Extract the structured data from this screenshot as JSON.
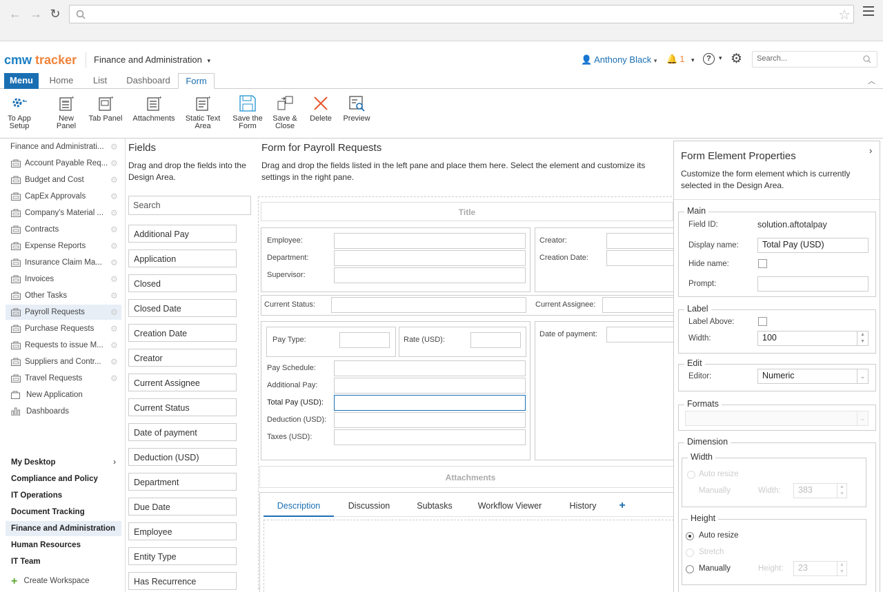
{
  "app": {
    "logo_cmw": "cmw",
    "logo_tracker": "tracker",
    "workspace": "Finance and Administration",
    "user": "Anthony Black",
    "notif_count": "1",
    "search_placeholder": "Search..."
  },
  "tabs": [
    "Menu",
    "Home",
    "List",
    "Dashboard",
    "Form"
  ],
  "ribbon": [
    {
      "l1": "To App",
      "l2": "Setup",
      "icon": "gear-back-icon"
    },
    {
      "l1": "New",
      "l2": "Panel",
      "icon": "new-panel-icon"
    },
    {
      "l1": "Tab Panel",
      "l2": "",
      "icon": "tab-panel-icon"
    },
    {
      "l1": "Attachments",
      "l2": "",
      "icon": "attachments-icon"
    },
    {
      "l1": "Static Text",
      "l2": "Area",
      "icon": "static-text-icon"
    },
    {
      "l1": "Save the",
      "l2": "Form",
      "icon": "save-icon"
    },
    {
      "l1": "Save &",
      "l2": "Close",
      "icon": "save-close-icon"
    },
    {
      "l1": "Delete",
      "l2": "",
      "icon": "delete-icon"
    },
    {
      "l1": "Preview",
      "l2": "",
      "icon": "preview-icon"
    }
  ],
  "sidebar": {
    "header": "Finance and Administrati...",
    "items": [
      "Account Payable Req...",
      "Budget and Cost",
      "CapEx Approvals",
      "Company's Material ...",
      "Contracts",
      "Expense Reports",
      "Insurance Claim Ma...",
      "Invoices",
      "Other Tasks",
      "Payroll Requests",
      "Purchase Requests",
      "Requests to issue M...",
      "Suppliers and Contr...",
      "Travel Requests"
    ],
    "new_app": "New Application",
    "dashboards": "Dashboards",
    "workspaces": [
      "My Desktop",
      "Compliance and Policy",
      "IT Operations",
      "Document Tracking",
      "Finance and Administration",
      "Human Resources",
      "IT Team"
    ],
    "create": "Create Workspace"
  },
  "fields": {
    "title": "Fields",
    "desc": "Drag and drop the fields into the Design Area.",
    "search": "Search",
    "items": [
      "Additional Pay",
      "Application",
      "Closed",
      "Closed Date",
      "Creation Date",
      "Creator",
      "Current Assignee",
      "Current Status",
      "Date of payment",
      "Deduction (USD)",
      "Department",
      "Due Date",
      "Employee",
      "Entity Type",
      "Has Recurrence"
    ]
  },
  "design": {
    "title": "Form for Payroll Requests",
    "desc": "Drag and drop the fields listed in the left pane and place them here. Select the element and customize its settings in the right pane.",
    "form_title": "Title",
    "employee": "Employee:",
    "department": "Department:",
    "supervisor": "Supervisor:",
    "creator": "Creator:",
    "creation_date": "Creation Date:",
    "current_status": "Current Status:",
    "current_assignee": "Current Assignee:",
    "pay_type": "Pay Type:",
    "rate": "Rate (USD):",
    "date_payment": "Date of payment:",
    "pay_schedule": "Pay Schedule:",
    "additional_pay": "Additional Pay:",
    "total_pay": "Total Pay (USD):",
    "deduction": "Deduction (USD):",
    "taxes": "Taxes (USD):",
    "attachments": "Attachments",
    "tabs": [
      "Description",
      "Discussion",
      "Subtasks",
      "Workflow Viewer",
      "History"
    ]
  },
  "props": {
    "title": "Form Element Properties",
    "desc": "Customize the form element which is currently selected in the Design Area.",
    "main": "Main",
    "field_id_l": "Field ID:",
    "field_id": "solution.aftotalpay",
    "display_l": "Display name:",
    "display": "Total Pay (USD)",
    "hide_l": "Hide name:",
    "prompt_l": "Prompt:",
    "label": "Label",
    "label_above": "Label Above:",
    "width_l": "Width:",
    "width": "100",
    "edit": "Edit",
    "editor_l": "Editor:",
    "editor": "Numeric",
    "formats": "Formats",
    "dimension": "Dimension",
    "d_width": "Width",
    "auto_resize": "Auto resize",
    "manually": "Manually",
    "w_l": "Width:",
    "w_val": "383",
    "d_height": "Height",
    "stretch": "Stretch",
    "h_l": "Height:",
    "h_val": "23"
  }
}
